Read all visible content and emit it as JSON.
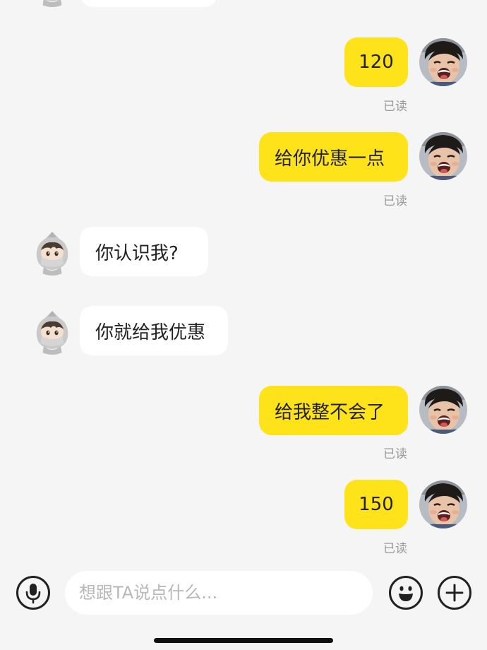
{
  "messages": [
    {
      "side": "mine",
      "text": "120",
      "status": "已读"
    },
    {
      "side": "mine",
      "text": "给你优惠一点",
      "status": "已读"
    },
    {
      "side": "theirs",
      "text": "你认识我?"
    },
    {
      "side": "theirs",
      "text": "你就给我优惠"
    },
    {
      "side": "mine",
      "text": "给我整不会了",
      "status": "已读"
    },
    {
      "side": "mine",
      "text": "150",
      "status": "已读"
    }
  ],
  "input": {
    "placeholder": "想跟TA说点什么..."
  },
  "colors": {
    "background": "#f5f5f5",
    "my_bubble": "#fee31a",
    "their_bubble": "#ffffff",
    "read_text": "#9a9a9a"
  },
  "icons": {
    "voice": "microphone-icon",
    "emoji": "emoji-icon",
    "more": "plus-icon"
  }
}
